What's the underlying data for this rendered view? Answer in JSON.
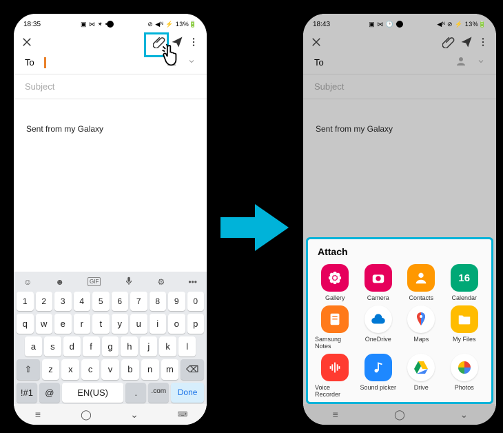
{
  "left": {
    "time": "18:35",
    "status_left": "▣ ⋈ ✴ •",
    "battery": "⊘ ◀ᴺ ⚡ 13%🔋",
    "to_label": "To",
    "subject_placeholder": "Subject",
    "body": "Sent from my Galaxy",
    "kb_lang": "EN(US)",
    "kb_com": ".com",
    "kb_done": "Done",
    "kb_sym": "!#1",
    "kb_numbers": [
      "1",
      "2",
      "3",
      "4",
      "5",
      "6",
      "7",
      "8",
      "9",
      "0"
    ],
    "kb_row1": [
      "q",
      "w",
      "e",
      "r",
      "t",
      "y",
      "u",
      "i",
      "o",
      "p"
    ],
    "kb_row2": [
      "a",
      "s",
      "d",
      "f",
      "g",
      "h",
      "j",
      "k",
      "l"
    ],
    "kb_row3": [
      "z",
      "x",
      "c",
      "v",
      "b",
      "n",
      "m"
    ]
  },
  "right": {
    "time": "18:43",
    "status_left": "▣ ⋈ 🕒 •",
    "battery": "◀ᴺ ⊘ ⚡ 13%🔋",
    "to_label": "To",
    "subject_placeholder": "Subject",
    "body": "Sent from my Galaxy",
    "attach_title": "Attach",
    "items": [
      {
        "label": "Gallery",
        "bg": "#e6005c",
        "glyph": "flower"
      },
      {
        "label": "Camera",
        "bg": "#e6005c",
        "glyph": "camera"
      },
      {
        "label": "Contacts",
        "bg": "#ff9800",
        "glyph": "person"
      },
      {
        "label": "Calendar",
        "bg": "#00a876",
        "glyph": "16"
      },
      {
        "label": "Samsung Notes",
        "bg": "#ff7a1a",
        "glyph": "note"
      },
      {
        "label": "OneDrive",
        "bg": "circle",
        "glyph": "cloud"
      },
      {
        "label": "Maps",
        "bg": "circle",
        "glyph": "pin"
      },
      {
        "label": "My Files",
        "bg": "#ffbc00",
        "glyph": "folder"
      },
      {
        "label": "Voice Recorder",
        "bg": "#ff3b30",
        "glyph": "wave"
      },
      {
        "label": "Sound picker",
        "bg": "#1e88ff",
        "glyph": "music"
      },
      {
        "label": "Drive",
        "bg": "circle",
        "glyph": "drive"
      },
      {
        "label": "Photos",
        "bg": "circle",
        "glyph": "photos"
      }
    ]
  }
}
